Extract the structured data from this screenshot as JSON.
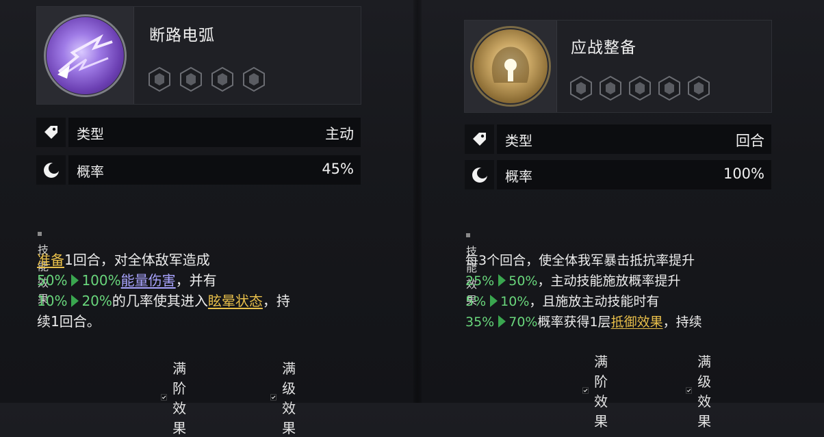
{
  "cards": [
    {
      "name": "断路电弧",
      "type_label": "类型",
      "type_value": "主动",
      "rate_label": "概率",
      "rate_value": "45%",
      "section_title": "技能效果",
      "stars": 4,
      "desc": {
        "l1a": "准备",
        "l1b": "1回合，对全体敌军造成",
        "l2a": "50%",
        "l2b": "100%",
        "l2c": "能量伤害",
        "l2d": "，并有",
        "l3a": "10%",
        "l3b": "20%",
        "l3c": "的几率使其进入",
        "l3d": "眩晕状态",
        "l3e": "，持",
        "l4": "续1回合。"
      },
      "check1": "满阶效果",
      "check2": "满级效果"
    },
    {
      "name": "应战整备",
      "type_label": "类型",
      "type_value": "回合",
      "rate_label": "概率",
      "rate_value": "100%",
      "section_title": "技能效果",
      "stars": 5,
      "desc": {
        "l1": "每3个回合，使全体我军暴击抵抗率提升",
        "l2a": "25%",
        "l2b": "50%",
        "l2c": "，主动技能施放概率提升",
        "l3a": "5%",
        "l3b": "10%",
        "l3c": "，且施放主动技能时有",
        "l4a": "35%",
        "l4b": "70%",
        "l4c": "概率获得1层",
        "l4d": "抵御效果",
        "l4e": "，持续"
      },
      "check1": "满阶效果",
      "check2": "满级效果"
    }
  ],
  "colors": {
    "green": "#69d67c",
    "gold": "#e8bf4a",
    "purple": "#a9a4ff"
  }
}
